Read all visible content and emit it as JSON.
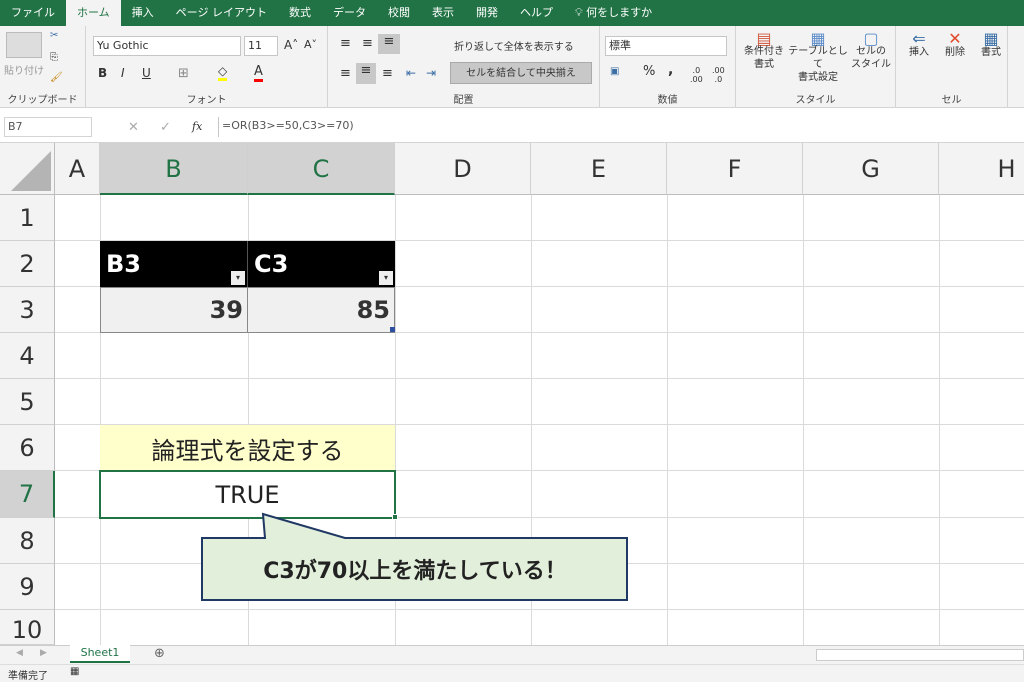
{
  "tabs": [
    "ファイル",
    "ホーム",
    "挿入",
    "ページ レイアウト",
    "数式",
    "データ",
    "校閲",
    "表示",
    "開発",
    "ヘルプ"
  ],
  "tell_me": "何をしますか",
  "ribbon": {
    "clipboard": {
      "label": "クリップボード",
      "paste": "貼り付け"
    },
    "font": {
      "label": "フォント",
      "name": "Yu Gothic",
      "size": "11",
      "bold": "B",
      "italic": "I",
      "underline": "U"
    },
    "alignment": {
      "label": "配置",
      "wrap": "折り返して全体を表示する",
      "merge": "セルを結合して中央揃え"
    },
    "number": {
      "label": "数値",
      "format": "標準",
      "percent": "%",
      "comma": ","
    },
    "styles": {
      "label": "スタイル",
      "conditional": "条件付き\n書式",
      "table": "テーブルとして\n書式設定",
      "cell_styles": "セルの\nスタイル"
    },
    "cells": {
      "label": "セル",
      "insert": "挿入",
      "delete": "削除",
      "format": "書式"
    }
  },
  "formula_bar": {
    "name_box": "B7",
    "formula": "=OR(B3>=50,C3>=70)",
    "fx": "fx"
  },
  "columns": [
    "A",
    "B",
    "C",
    "D",
    "E",
    "F",
    "G",
    "H"
  ],
  "rows": [
    "1",
    "2",
    "3",
    "4",
    "5",
    "6",
    "7",
    "8",
    "9",
    "10"
  ],
  "table": {
    "headers": [
      "B3",
      "C3"
    ],
    "values": [
      "39",
      "85"
    ]
  },
  "label_cell": "論理式を設定する",
  "result_cell": "TRUE",
  "callout": "C3が70以上を満たしている！",
  "sheet_tab": "Sheet1",
  "status": "準備完了",
  "colors": {
    "excel_green": "#217346",
    "table_header": "#000000",
    "label_fill": "#ffffcc",
    "callout_fill": "#e2efda"
  }
}
